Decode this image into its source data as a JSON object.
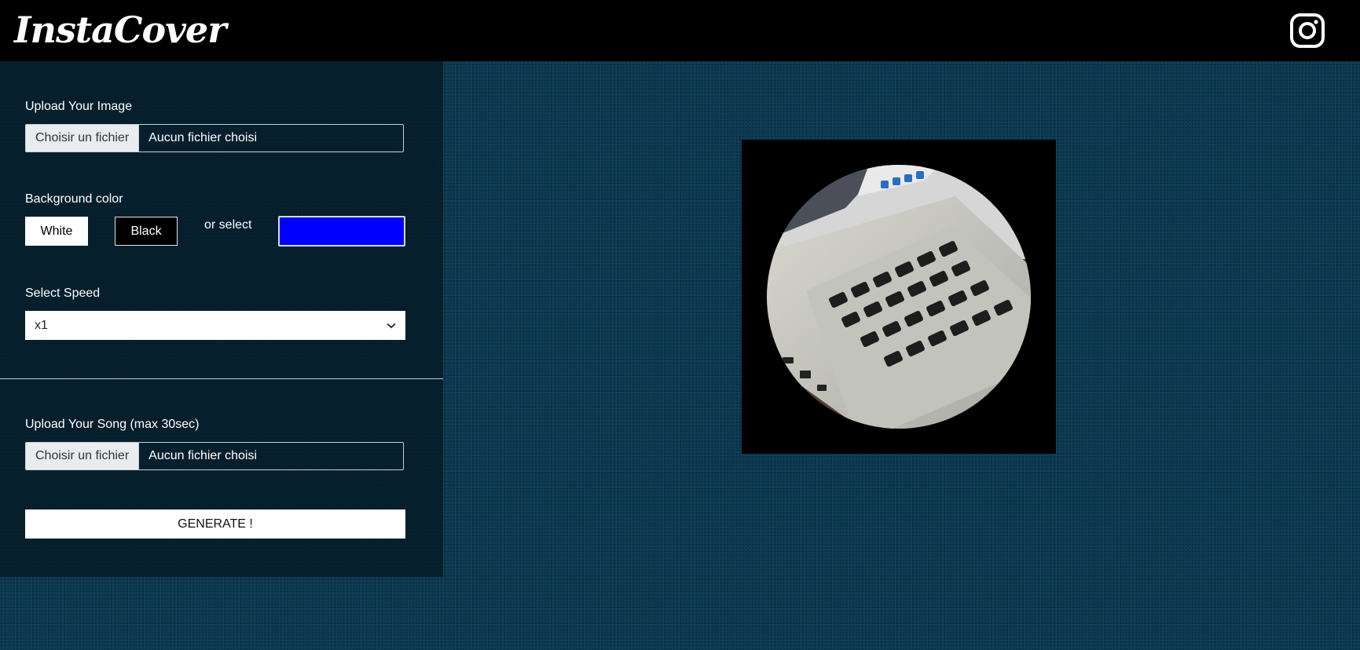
{
  "header": {
    "logo_text": "InstaCover",
    "instagram_icon": "instagram-icon"
  },
  "form": {
    "image_label": "Upload Your Image",
    "image_file_button": "Choisir un fichier",
    "image_file_status": "Aucun fichier choisi",
    "bg_label": "Background color",
    "white_label": "White",
    "black_label": "Black",
    "or_select": "or select",
    "selected_color": "#0000ff",
    "speed_label": "Select Speed",
    "speed_value": "x1",
    "song_label": "Upload Your Song (max 30sec)",
    "song_file_button": "Choisir un fichier",
    "song_file_status": "Aucun fichier choisi",
    "generate_label": "GENERATE !"
  },
  "colors": {
    "page_bg": "#0b3a52",
    "panel_bg": "#05182a",
    "accent_blue": "#0000ff"
  }
}
